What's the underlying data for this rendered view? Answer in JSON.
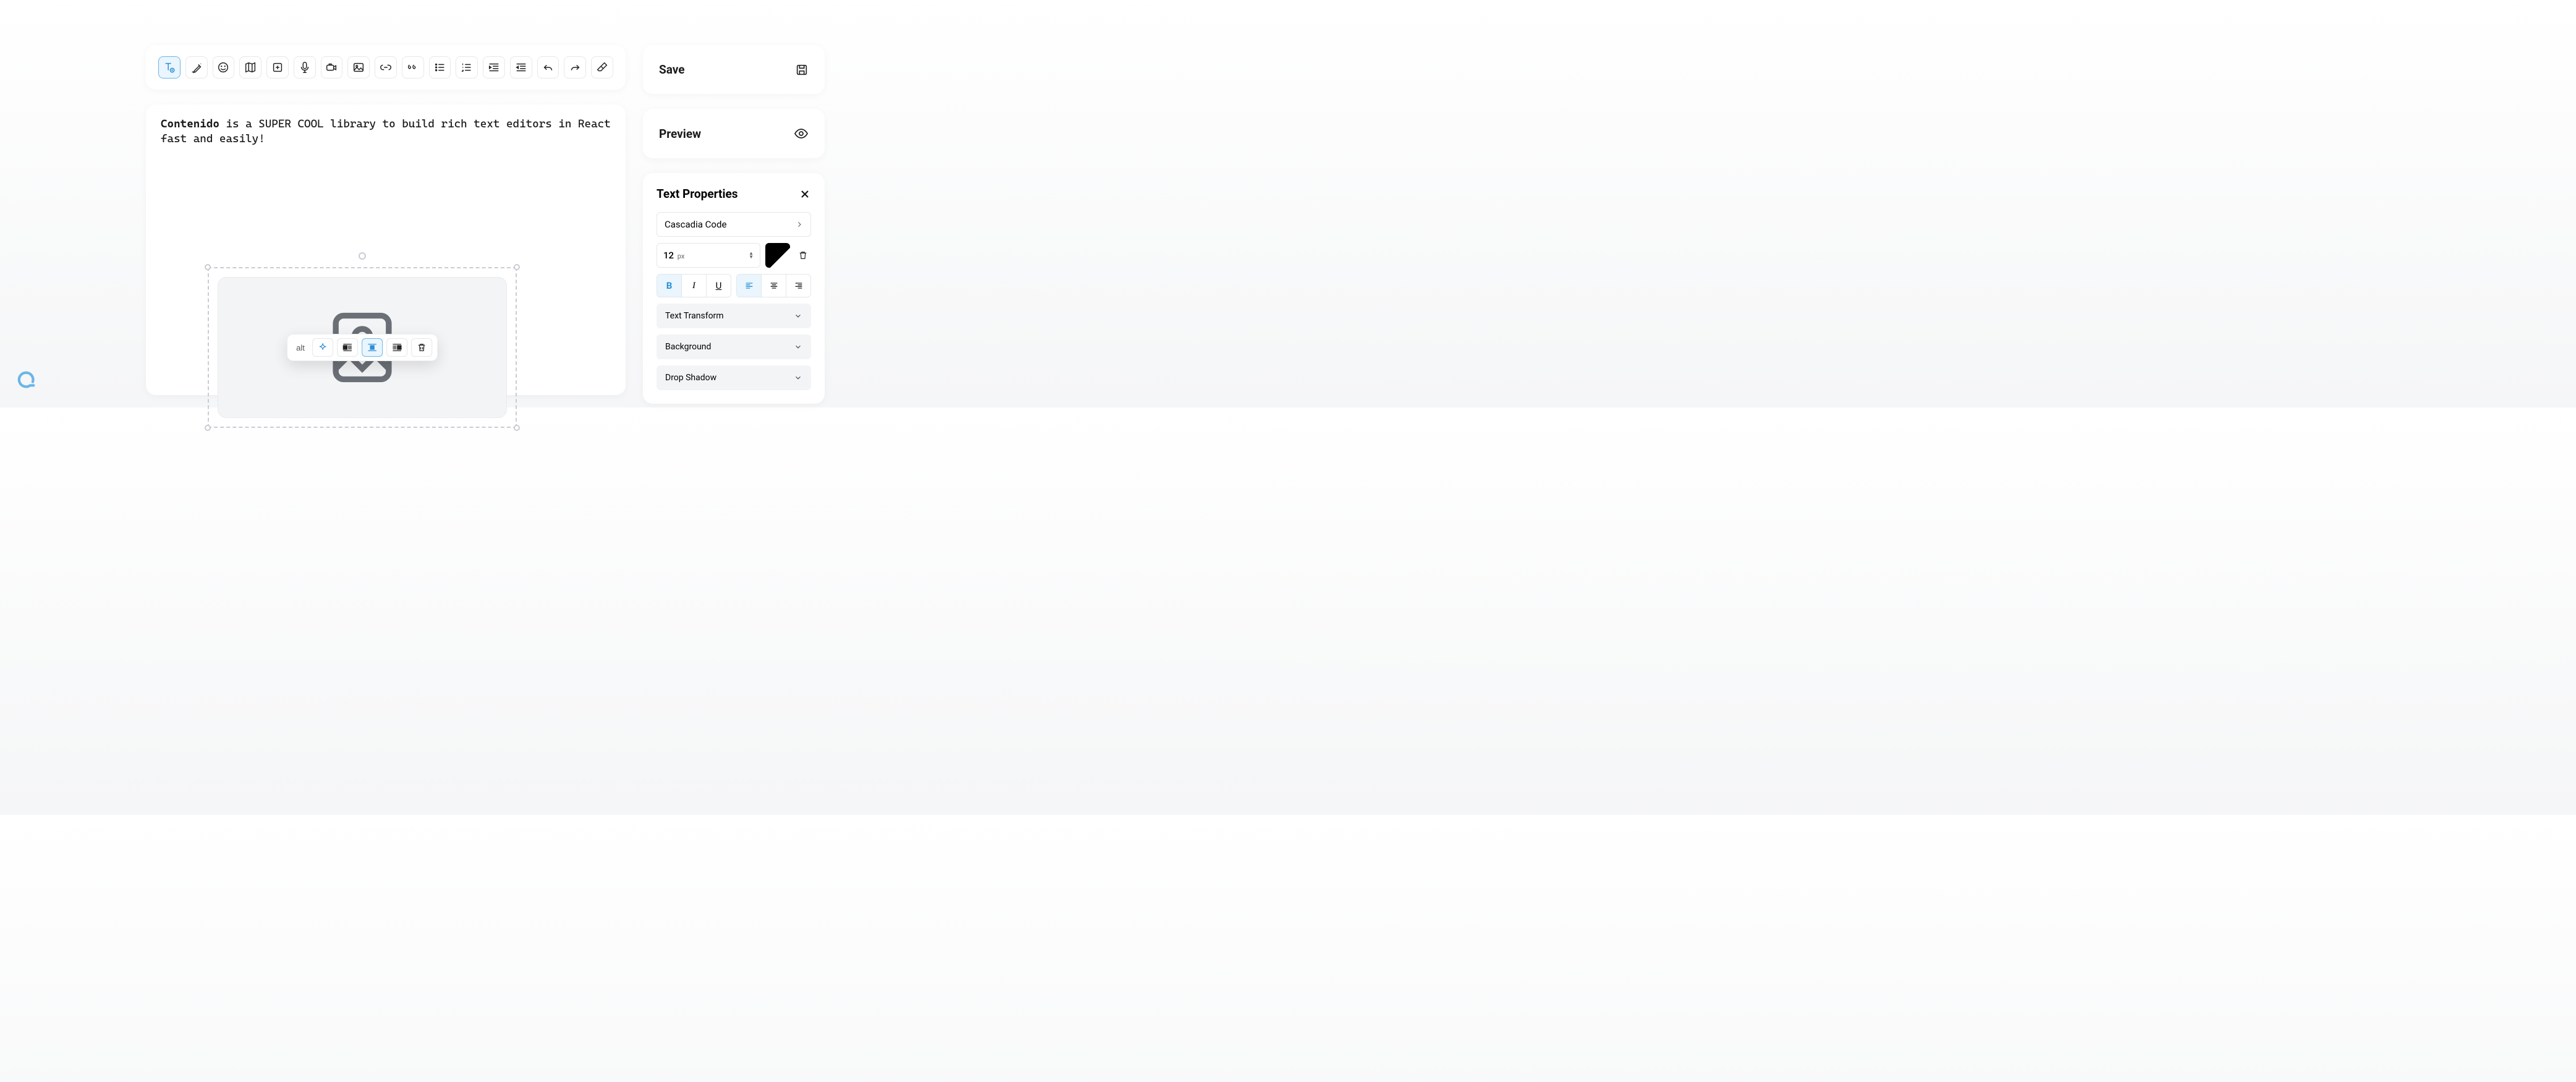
{
  "editor_content": {
    "bold_word": "Contenido",
    "rest": " is a SUPER COOL library to build rich text editors in React fast and easily!"
  },
  "image_toolbar": {
    "alt_label": "alt"
  },
  "actions": {
    "save": "Save",
    "preview": "Preview"
  },
  "props": {
    "title": "Text Properties",
    "font_family": "Cascadia Code",
    "font_size": "12",
    "font_unit": "px",
    "style": {
      "bold": "B",
      "italic": "I",
      "underline": "U"
    },
    "sections": {
      "transform": "Text Transform",
      "background": "Background",
      "shadow": "Drop Shadow"
    }
  }
}
